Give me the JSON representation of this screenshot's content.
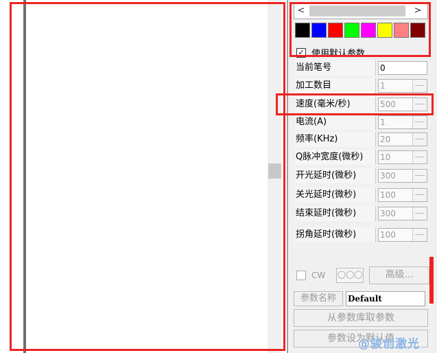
{
  "swatch_colors": [
    "#000000",
    "#0000ff",
    "#ff0000",
    "#00ff00",
    "#ff00ff",
    "#ffff00",
    "#ff8080",
    "#800000"
  ],
  "scroll": {
    "left_arrow": "<",
    "right_arrow": ">"
  },
  "use_default_params": {
    "label": "使用默认参数",
    "checked": true,
    "mark": "✓"
  },
  "params": [
    {
      "label": "当前笔号",
      "value": "0",
      "enabled": true
    },
    {
      "label": "加工数目",
      "value": "1",
      "enabled": false
    },
    {
      "label": "速度(毫米/秒)",
      "value": "500",
      "enabled": false
    },
    {
      "label": "电流(A)",
      "value": "1",
      "enabled": false
    },
    {
      "label": "频率(KHz)",
      "value": "20",
      "enabled": false
    },
    {
      "label": "Q脉冲宽度(微秒)",
      "value": "10",
      "enabled": false
    },
    {
      "label": "开光延时(微秒)",
      "value": "300",
      "enabled": false
    },
    {
      "label": "关光延时(微秒)",
      "value": "100",
      "enabled": false
    },
    {
      "label": "结束延时(微秒)",
      "value": "300",
      "enabled": false
    },
    {
      "label": "拐角延时(微秒)",
      "value": "100",
      "enabled": false
    }
  ],
  "cw": {
    "label": "CW",
    "checked": false
  },
  "ring_button": "◯◯◯",
  "advanced_button": "高级...",
  "param_name_button": "参数名称",
  "param_name_value": "Default",
  "fetch_from_library_button": "从参数库取参数",
  "set_default_button": "参数设为默认值",
  "watermark": "@骏创激光",
  "accent_color": "#ee2222"
}
